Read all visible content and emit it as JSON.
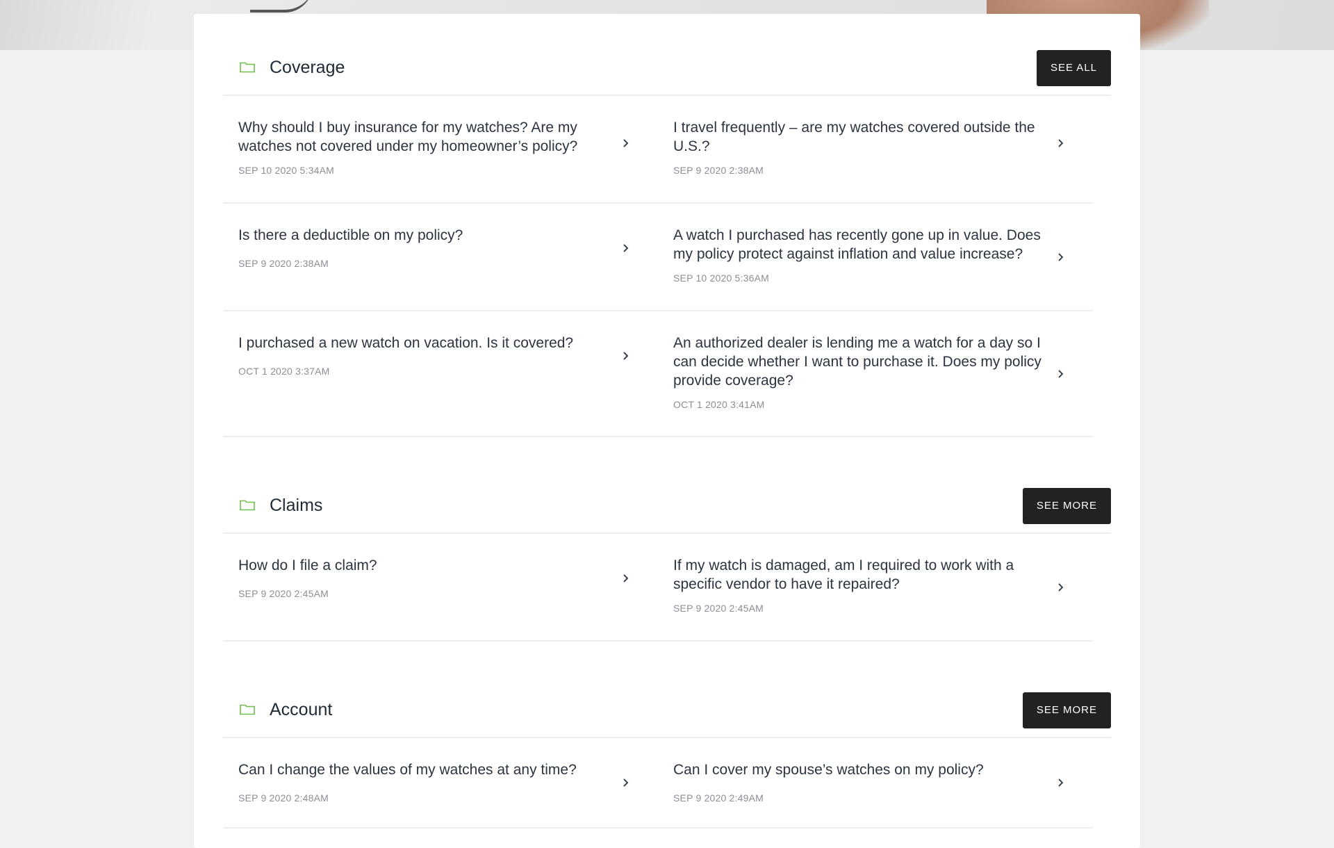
{
  "sections": [
    {
      "title": "Coverage",
      "button": "SEE ALL",
      "items": [
        {
          "question": "Why should I buy insurance for my watches? Are my watches not covered under my homeowner’s policy?",
          "date": "SEP 10 2020 5:34AM"
        },
        {
          "question": "I travel frequently – are my watches covered outside the U.S.?",
          "date": "SEP 9 2020 2:38AM"
        },
        {
          "question": "Is there a deductible on my policy?",
          "date": "SEP 9 2020 2:38AM"
        },
        {
          "question": "A watch I purchased has recently gone up in value. Does my policy protect against inflation and value increase?",
          "date": "SEP 10 2020 5:36AM"
        },
        {
          "question": "I purchased a new watch on vacation. Is it covered?",
          "date": "OCT 1 2020 3:37AM"
        },
        {
          "question": "An authorized dealer is lending me a watch for a day so I can decide whether I want to purchase it. Does my policy provide coverage?",
          "date": "OCT 1 2020 3:41AM"
        }
      ]
    },
    {
      "title": "Claims",
      "button": "SEE MORE",
      "items": [
        {
          "question": "How do I file a claim?",
          "date": "SEP 9 2020 2:45AM"
        },
        {
          "question": "If my watch is damaged, am I required to work with a specific vendor to have it repaired?",
          "date": "SEP 9 2020 2:45AM"
        }
      ]
    },
    {
      "title": "Account",
      "button": "SEE MORE",
      "items": [
        {
          "question": "Can I change the values of my watches at any time?",
          "date": "SEP 9 2020 2:48AM"
        },
        {
          "question": "Can I cover my spouse’s watches on my policy?",
          "date": "SEP 9 2020 2:49AM"
        }
      ]
    }
  ],
  "colors": {
    "folder_icon": "#6cbf4a",
    "button_bg": "#222222",
    "divider": "#eeeeee"
  },
  "icons": {
    "folder": "folder-icon",
    "chevron": "chevron-right-icon"
  }
}
